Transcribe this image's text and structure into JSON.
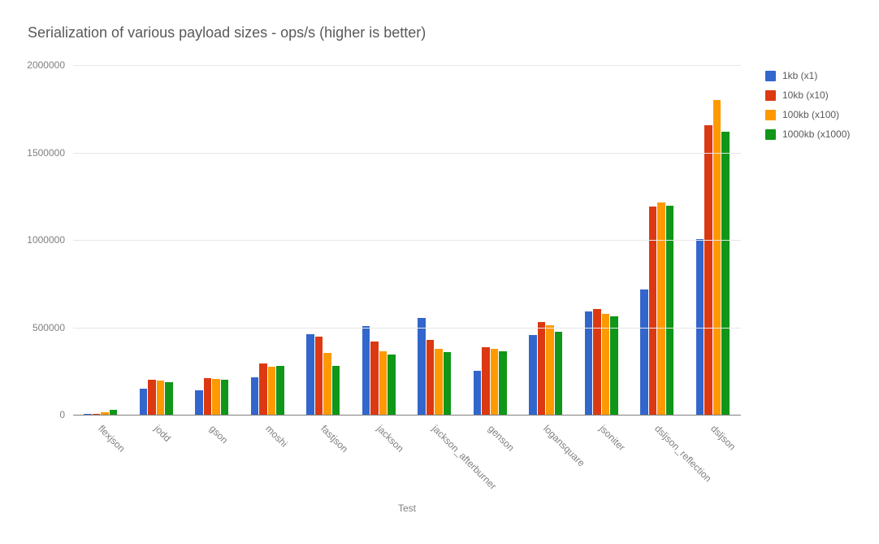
{
  "title": "Serialization of various payload sizes  - ops/s (higher is better)",
  "xaxis_title": "Test",
  "yaxis": {
    "min": 0,
    "max": 2000000,
    "step": 500000,
    "ticks": [
      0,
      500000,
      1000000,
      1500000,
      2000000
    ]
  },
  "legend": [
    {
      "name": "1kb (x1)",
      "color": "#3366cc"
    },
    {
      "name": "10kb (x10)",
      "color": "#dc3912"
    },
    {
      "name": "100kb (x100)",
      "color": "#ff9900"
    },
    {
      "name": "1000kb (x1000)",
      "color": "#109618"
    }
  ],
  "chart_data": {
    "type": "bar",
    "title": "Serialization of various payload sizes  - ops/s (higher is better)",
    "xlabel": "Test",
    "ylabel": "",
    "ylim": [
      0,
      2000000
    ],
    "categories": [
      "flexjson",
      "jodd",
      "gson",
      "moshi",
      "fastjson",
      "jackson",
      "jackson_afterburner",
      "genson",
      "logansquare",
      "jsoniter",
      "dsljson_reflection",
      "dsljson"
    ],
    "series": [
      {
        "name": "1kb (x1)",
        "color": "#3366cc",
        "values": [
          3000,
          150000,
          140000,
          215000,
          460000,
          505000,
          555000,
          250000,
          455000,
          590000,
          715000,
          1005000
        ]
      },
      {
        "name": "10kb (x10)",
        "color": "#dc3912",
        "values": [
          5000,
          200000,
          210000,
          295000,
          445000,
          420000,
          430000,
          385000,
          530000,
          605000,
          1190000,
          1655000
        ]
      },
      {
        "name": "100kb (x100)",
        "color": "#ff9900",
        "values": [
          15000,
          195000,
          205000,
          275000,
          355000,
          365000,
          375000,
          375000,
          510000,
          578000,
          1215000,
          1800000
        ]
      },
      {
        "name": "1000kb (x1000)",
        "color": "#109618",
        "values": [
          30000,
          185000,
          200000,
          280000,
          280000,
          345000,
          360000,
          365000,
          475000,
          565000,
          1195000,
          1620000
        ]
      }
    ]
  }
}
